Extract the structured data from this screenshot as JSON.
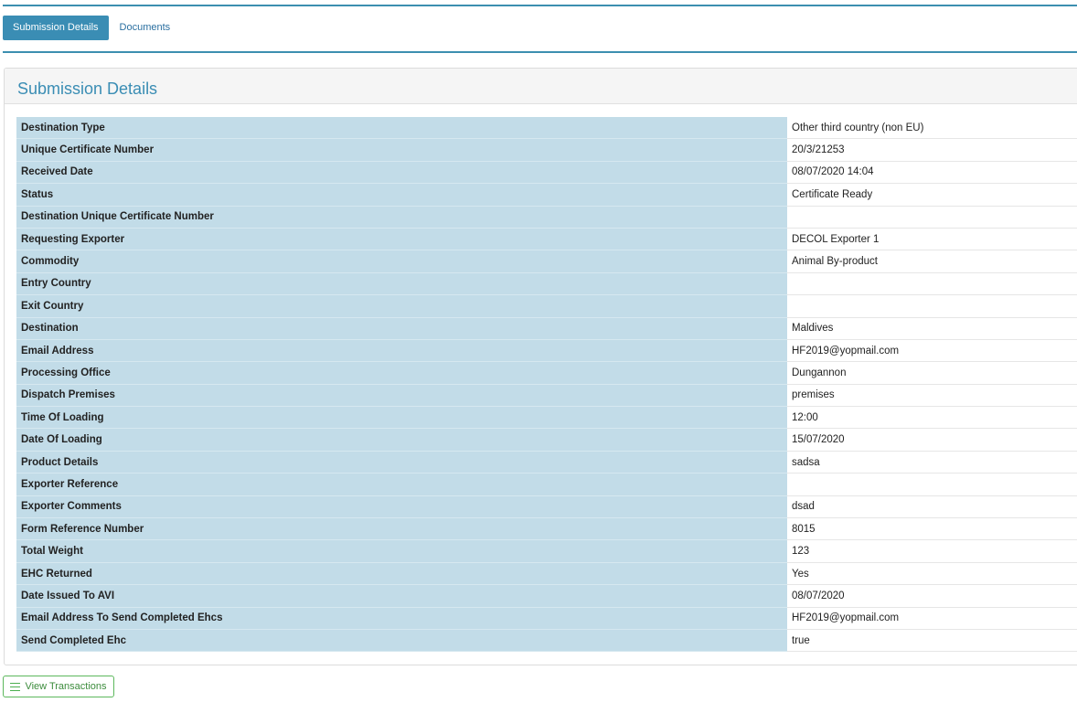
{
  "tabs": [
    {
      "label": "Submission Details",
      "active": true
    },
    {
      "label": "Documents",
      "active": false
    }
  ],
  "panel": {
    "title": "Submission Details"
  },
  "details": [
    {
      "label": "Destination Type",
      "value": "Other third country (non EU)"
    },
    {
      "label": "Unique Certificate Number",
      "value": "20/3/21253"
    },
    {
      "label": "Received Date",
      "value": "08/07/2020 14:04"
    },
    {
      "label": "Status",
      "value": "Certificate Ready"
    },
    {
      "label": "Destination Unique Certificate Number",
      "value": ""
    },
    {
      "label": "Requesting Exporter",
      "value": "DECOL Exporter 1"
    },
    {
      "label": "Commodity",
      "value": "Animal By-product"
    },
    {
      "label": "Entry Country",
      "value": ""
    },
    {
      "label": "Exit Country",
      "value": ""
    },
    {
      "label": "Destination",
      "value": "Maldives"
    },
    {
      "label": "Email Address",
      "value": "HF2019@yopmail.com"
    },
    {
      "label": "Processing Office",
      "value": "Dungannon"
    },
    {
      "label": "Dispatch Premises",
      "value": "premises"
    },
    {
      "label": "Time Of Loading",
      "value": "12:00"
    },
    {
      "label": "Date Of Loading",
      "value": "15/07/2020"
    },
    {
      "label": "Product Details",
      "value": "sadsa"
    },
    {
      "label": "Exporter Reference",
      "value": ""
    },
    {
      "label": "Exporter Comments",
      "value": "dsad"
    },
    {
      "label": "Form Reference Number",
      "value": "8015"
    },
    {
      "label": "Total Weight",
      "value": "123"
    },
    {
      "label": "EHC Returned",
      "value": "Yes"
    },
    {
      "label": "Date Issued To AVI",
      "value": "08/07/2020"
    },
    {
      "label": "Email Address To Send Completed Ehcs",
      "value": "HF2019@yopmail.com"
    },
    {
      "label": "Send Completed Ehc",
      "value": "true"
    }
  ],
  "actions": {
    "view_transactions_label": "View Transactions",
    "view_transactions_icon": "list-icon"
  },
  "colors": {
    "accent": "#3a8db4",
    "label_bg": "#c2dce8",
    "success": "#5cb85c"
  }
}
